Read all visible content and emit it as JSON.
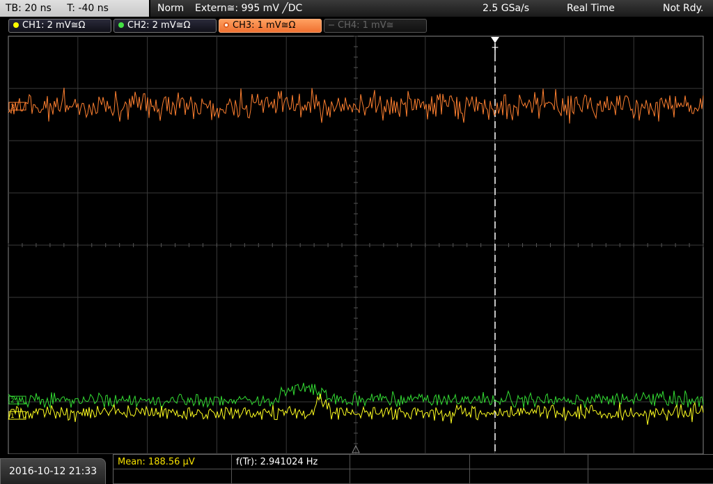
{
  "topbar": {
    "timebase": "TB: 20 ns",
    "trigger_time": "T: -40 ns",
    "mode": "Norm",
    "trigger_source": "Extern≅: 995 mV ╱DC",
    "sample_rate": "2.5 GSa/s",
    "acq_mode": "Real Time",
    "status": "Not Rdy."
  },
  "channels": [
    {
      "label": "CH1: 2 mV≅Ω",
      "color": "#ffff00",
      "state": "on"
    },
    {
      "label": "CH2: 2 mV≅Ω",
      "color": "#44e044",
      "state": "on"
    },
    {
      "label": "CH3: 1 mV≅Ω",
      "color": "#ff8040",
      "state": "active"
    },
    {
      "label": "CH4: 1 mV≅",
      "color": "#666666",
      "state": "off"
    }
  ],
  "trigger_marker": "T",
  "traces": {
    "ch3_color": "#ff8030",
    "ch2_color": "#33dd33",
    "ch1_color": "#ffff20"
  },
  "bottom": {
    "datetime": "2016-10-12 21:33",
    "mean": "Mean: 188.56 µV",
    "freq": "f(Tr): 2.941024 Hz"
  }
}
